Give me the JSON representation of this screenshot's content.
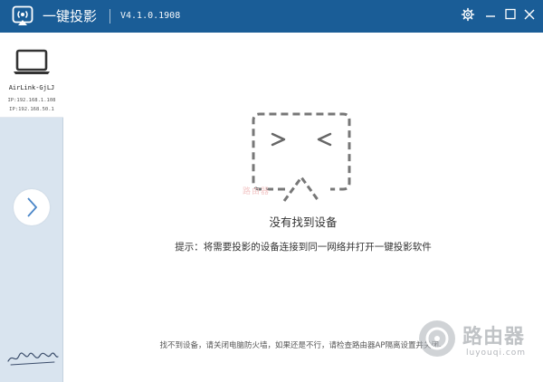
{
  "titlebar": {
    "app_title": "一键投影",
    "version": "V4.1.0.1908"
  },
  "sidebar": {
    "device": {
      "name": "AirLink-GjLJ",
      "ip1": "IP:192.168.1.108",
      "ip2": "IP:192.168.50.1"
    }
  },
  "main": {
    "watermark_small": "路由器",
    "no_device": "没有找到设备",
    "hint": "提示：将需要投影的设备连接到同一网络并打开一键投影软件",
    "footer_note": "找不到设备，请关闭电脑防火墙，如果还是不行，请检查路由器AP隔离设置并关闭。"
  },
  "site_watermark": {
    "text": "路由器",
    "sub": "luyouqi.com"
  },
  "colors": {
    "titlebar": "#1a5d97",
    "sidebar": "#d9e4ef",
    "accent": "#4a86c8"
  },
  "icons": {
    "logo": "cast-icon",
    "settings": "gear-icon",
    "minimize": "minimize-icon",
    "maximize": "maximize-icon",
    "close": "close-icon",
    "device": "laptop-icon",
    "next": "chevron-right-icon"
  }
}
